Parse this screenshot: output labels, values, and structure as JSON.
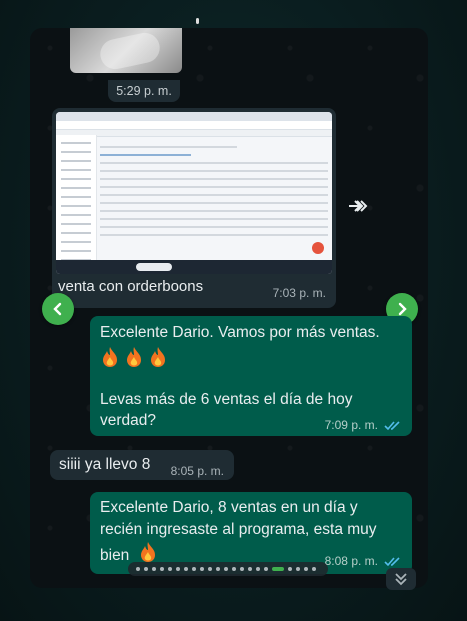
{
  "media_message": {
    "caption": "venta con orderboons",
    "time": "7:03 p. m."
  },
  "previous_time": "5:29 p. m.",
  "messages": [
    {
      "direction": "out",
      "line1": "Excelente Dario. Vamos por más ventas.",
      "emoji_count": 3,
      "line2": "Levas más de 6 ventas el día de hoy",
      "line3": "verdad?",
      "time": "7:09 p. m.",
      "read": true
    },
    {
      "direction": "in",
      "text": "siiii ya llevo 8",
      "time": "8:05 p. m."
    },
    {
      "direction": "out",
      "line1": "Excelente Dario, 8 ventas en un día y",
      "line2": "recién ingresaste al programa, esta muy",
      "line3": "bien",
      "time": "8:08 p. m.",
      "read": true
    }
  ],
  "icons": {
    "prev": "chevron-left-icon",
    "next": "chevron-right-icon",
    "forward": "forward-icon",
    "scroll_down": "double-chevron-down-icon",
    "emoji": "fire-emoji"
  },
  "colors": {
    "outgoing_bubble": "#005c4b",
    "incoming_bubble": "#1f2c33",
    "nav_button": "#3fb04e",
    "read_ticks": "#53bdeb"
  },
  "carousel": {
    "total_dots": 22,
    "active_index": 17
  }
}
